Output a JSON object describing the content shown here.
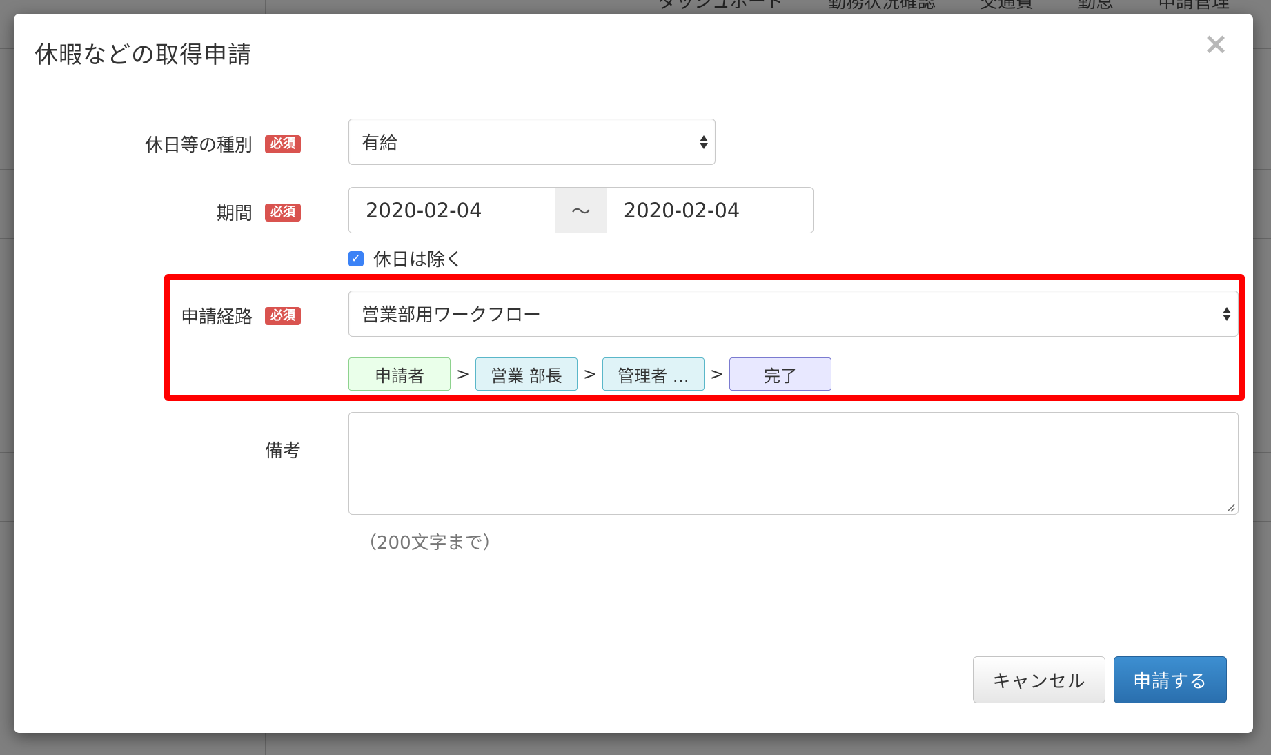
{
  "background_nav": {
    "items": [
      "ダッシュボード",
      "勤務状況確認",
      "交通費",
      "勤怠",
      "申請管理"
    ]
  },
  "modal": {
    "title": "休暇などの取得申請",
    "close_label": "×"
  },
  "form": {
    "required_badge": "必須",
    "leave_type": {
      "label": "休日等の種別",
      "value": "有給"
    },
    "period": {
      "label": "期間",
      "start": "2020-02-04",
      "separator": "〜",
      "end": "2020-02-04"
    },
    "exclude_holidays": {
      "label": "休日は除く",
      "checked": true
    },
    "route": {
      "label": "申請経路",
      "value": "営業部用ワークフロー",
      "steps": [
        {
          "label": "申請者",
          "bg": "#eaffea",
          "border": "#8ed28e"
        },
        {
          "label": "営業 部長",
          "bg": "#dff3f7",
          "border": "#5ab7c9"
        },
        {
          "label": "管理者 …",
          "bg": "#dff3f7",
          "border": "#5ab7c9"
        },
        {
          "label": "完了",
          "bg": "#e8e8ff",
          "border": "#7b7bd0"
        }
      ],
      "step_separator": ">"
    },
    "remarks": {
      "label": "備考",
      "value": "",
      "hint": "（200文字まで）"
    }
  },
  "footer": {
    "cancel_label": "キャンセル",
    "submit_label": "申請する"
  },
  "colors": {
    "required_badge": "#d9534f",
    "submit_button": "#2f7bbf",
    "highlight": "#ff0000"
  }
}
